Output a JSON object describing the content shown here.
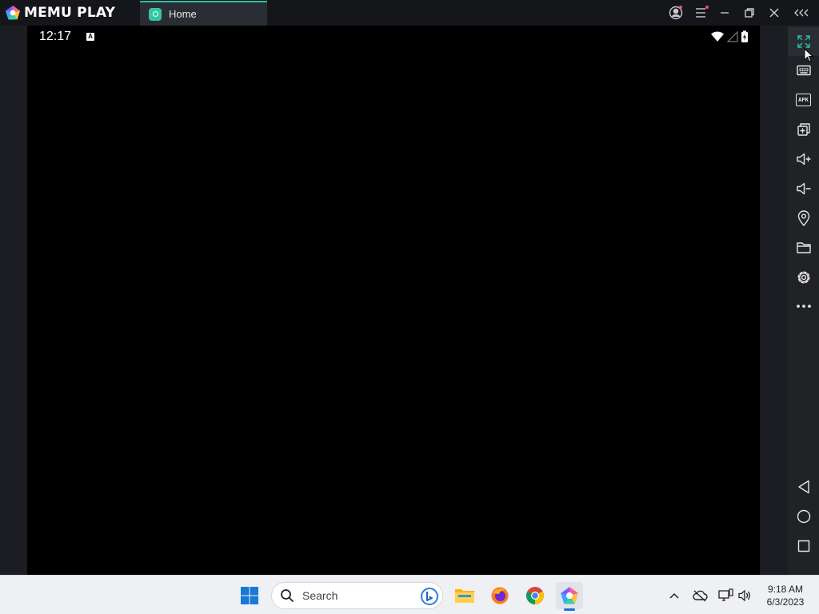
{
  "app": {
    "brand": "MEMU PLAY",
    "tab_label": "Home"
  },
  "android": {
    "time": "12:17",
    "ime_badge": "A"
  },
  "toolbar": {
    "icons": [
      "fullscreen-icon",
      "keyboard-icon",
      "apk-icon",
      "multi-instance-icon",
      "volume-up-icon",
      "volume-down-icon",
      "location-icon",
      "folder-icon",
      "settings-icon",
      "more-icon",
      "back-icon",
      "home-icon",
      "recents-icon"
    ],
    "apk_label": "APK"
  },
  "taskbar": {
    "search_label": "Search",
    "time": "9:18 AM",
    "date": "6/3/2023"
  },
  "colors": {
    "accent": "#2bbfa6",
    "titlebar": "#14161a",
    "toolbar": "#202226",
    "taskbar": "#eef0f4"
  }
}
